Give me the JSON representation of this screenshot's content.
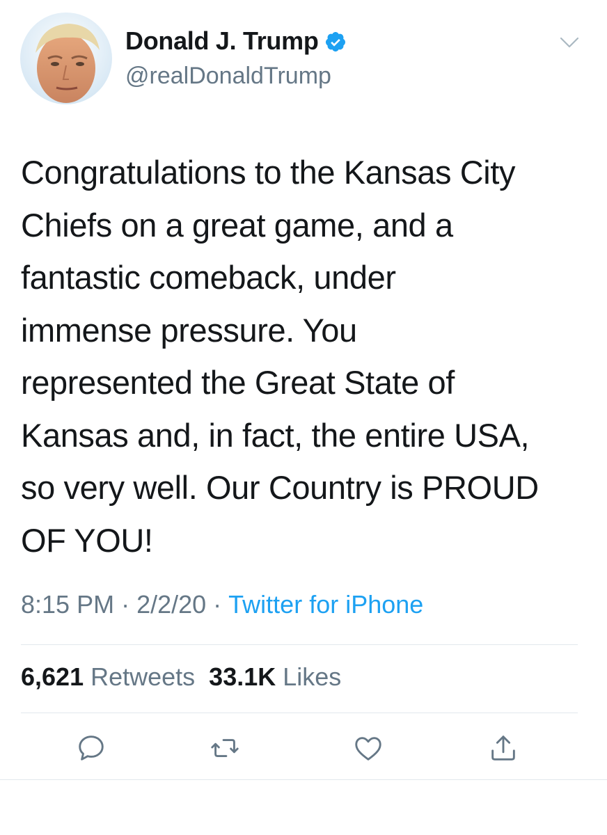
{
  "tweet": {
    "author": {
      "display_name": "Donald J. Trump",
      "handle": "@realDonaldTrump",
      "verified": true
    },
    "text": "Congratulations to the Kansas City\nChiefs on a great game, and a\nfantastic comeback, under\nimmense pressure. You\nrepresented the Great State of\nKansas and, in fact, the entire USA,\nso very well. Our Country is PROUD\nOF YOU!",
    "time": "8:15 PM",
    "separator": "·",
    "date": "2/2/20",
    "source": "Twitter for iPhone",
    "stats": {
      "retweets_count": "6,621",
      "retweets_label": "Retweets",
      "likes_count": "33.1K",
      "likes_label": "Likes"
    }
  },
  "icons": {
    "verified": "verified-badge-icon",
    "menu": "chevron-down-icon",
    "reply": "reply-icon",
    "retweet": "retweet-icon",
    "like": "heart-icon",
    "share": "share-icon"
  },
  "colors": {
    "text": "#14171a",
    "secondary": "#657786",
    "accent": "#1da1f2",
    "divider": "#e1e8ed"
  }
}
